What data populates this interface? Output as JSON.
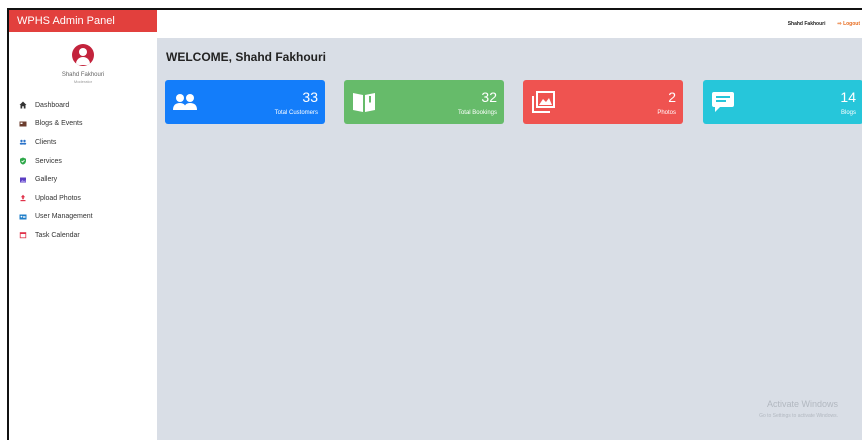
{
  "app": {
    "title": "WPHS Admin Panel"
  },
  "profile": {
    "name": "Shahd Fakhouri",
    "role": "Moderator"
  },
  "sidebar": {
    "items": [
      {
        "label": "Dashboard",
        "icon": "home-icon",
        "color": "#333333"
      },
      {
        "label": "Blogs & Events",
        "icon": "newspaper-icon",
        "color": "#6b3d2e"
      },
      {
        "label": "Clients",
        "icon": "users-icon",
        "color": "#2a73c9"
      },
      {
        "label": "Services",
        "icon": "shield-check-icon",
        "color": "#2ea84a"
      },
      {
        "label": "Gallery",
        "icon": "gallery-icon",
        "color": "#5b3ec2"
      },
      {
        "label": "Upload Photos",
        "icon": "upload-icon",
        "color": "#e0324a"
      },
      {
        "label": "User Management",
        "icon": "id-card-icon",
        "color": "#1e7ec9"
      },
      {
        "label": "Task Calendar",
        "icon": "calendar-icon",
        "color": "#e0324a"
      }
    ]
  },
  "topbar": {
    "user": "Shahd Fakhouri",
    "logout": "Logout"
  },
  "main": {
    "welcome": "WELCOME, Shahd Fakhouri",
    "cards": [
      {
        "value": "33",
        "label": "Total Customers",
        "color": "#137dfa",
        "icon": "users-icon"
      },
      {
        "value": "32",
        "label": "Total Bookings",
        "color": "#66bb6a",
        "icon": "book-open-icon"
      },
      {
        "value": "2",
        "label": "Photos",
        "color": "#ef5350",
        "icon": "photos-icon"
      },
      {
        "value": "14",
        "label": "Blogs",
        "color": "#26c6da",
        "icon": "comment-icon"
      }
    ]
  },
  "watermark": {
    "line1": "Activate Windows",
    "line2": "Go to Settings to activate Windows."
  }
}
